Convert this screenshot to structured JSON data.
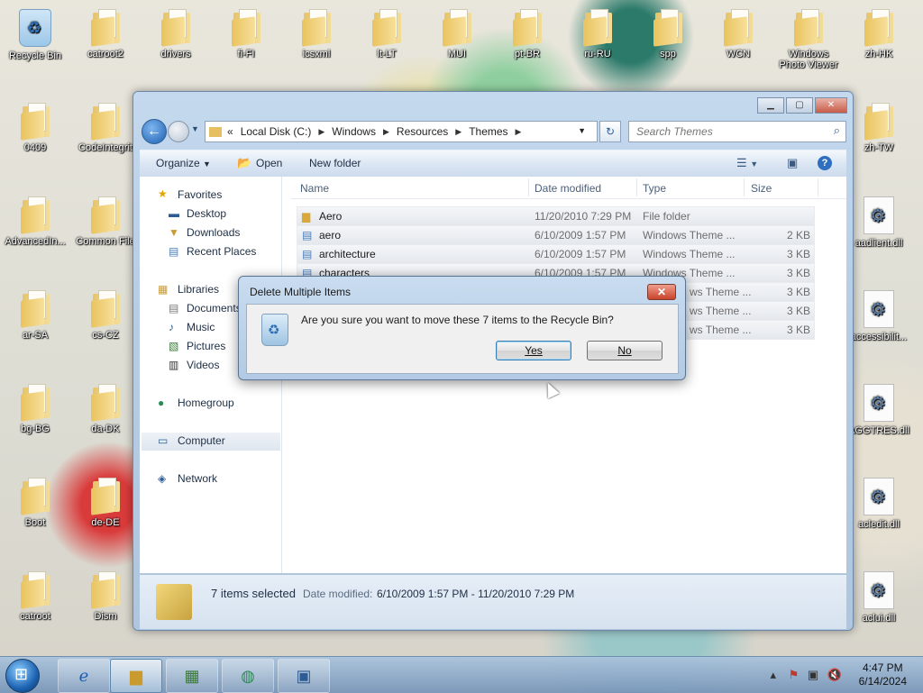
{
  "desktop": {
    "icons_row1": [
      "Recycle Bin",
      "catroot2",
      "drivers",
      "fi-FI",
      "icsxml",
      "lt-LT",
      "MUI",
      "pt-BR",
      "ru-RU",
      "spp",
      "WCN",
      "Windows Photo Viewer",
      "zh-HK"
    ],
    "icons_col1": [
      "0409",
      "AdvancedIn...",
      "ar-SA",
      "bg-BG",
      "Boot",
      "catroot"
    ],
    "icons_col2": [
      "CodeIntegrit",
      "Common File",
      "cs-CZ",
      "da-DK",
      "de-DE",
      "Dism"
    ],
    "icons_col_right": [
      "zh-TW",
      "aadlient.dll",
      "accessibilit...",
      "AGGTRES.dll",
      "acledit.dll",
      "aclui.dll"
    ]
  },
  "explorer": {
    "breadcrumb": [
      "«",
      "Local Disk (C:)",
      "Windows",
      "Resources",
      "Themes"
    ],
    "search_placeholder": "Search Themes",
    "toolbar": {
      "organize": "Organize",
      "open": "Open",
      "new_folder": "New folder"
    },
    "nav": {
      "favorites": "Favorites",
      "desktop": "Desktop",
      "downloads": "Downloads",
      "recent": "Recent Places",
      "libraries": "Libraries",
      "documents": "Documents",
      "music": "Music",
      "pictures": "Pictures",
      "videos": "Videos",
      "homegroup": "Homegroup",
      "computer": "Computer",
      "network": "Network"
    },
    "columns": {
      "name": "Name",
      "date": "Date modified",
      "type": "Type",
      "size": "Size"
    },
    "rows": [
      {
        "name": "Aero",
        "date": "11/20/2010 7:29 PM",
        "type": "File folder",
        "size": ""
      },
      {
        "name": "aero",
        "date": "6/10/2009 1:57 PM",
        "type": "Windows Theme ...",
        "size": "2 KB"
      },
      {
        "name": "architecture",
        "date": "6/10/2009 1:57 PM",
        "type": "Windows Theme ...",
        "size": "3 KB"
      },
      {
        "name": "characters",
        "date": "6/10/2009 1:57 PM",
        "type": "Windows Theme ...",
        "size": "3 KB"
      },
      {
        "name": "",
        "date": "",
        "type": "ws Theme ...",
        "size": "3 KB"
      },
      {
        "name": "",
        "date": "",
        "type": "ws Theme ...",
        "size": "3 KB"
      },
      {
        "name": "",
        "date": "",
        "type": "ws Theme ...",
        "size": "3 KB"
      }
    ],
    "status": {
      "count": "7 items selected",
      "date_label": "Date modified:",
      "date_value": "6/10/2009 1:57 PM - 11/20/2010 7:29 PM"
    }
  },
  "dialog": {
    "title": "Delete Multiple Items",
    "message": "Are you sure you want to move these 7 items to the Recycle Bin?",
    "yes": "Yes",
    "no": "No",
    "close": "✕"
  },
  "taskbar": {
    "time": "4:47 PM",
    "date": "6/14/2024"
  }
}
